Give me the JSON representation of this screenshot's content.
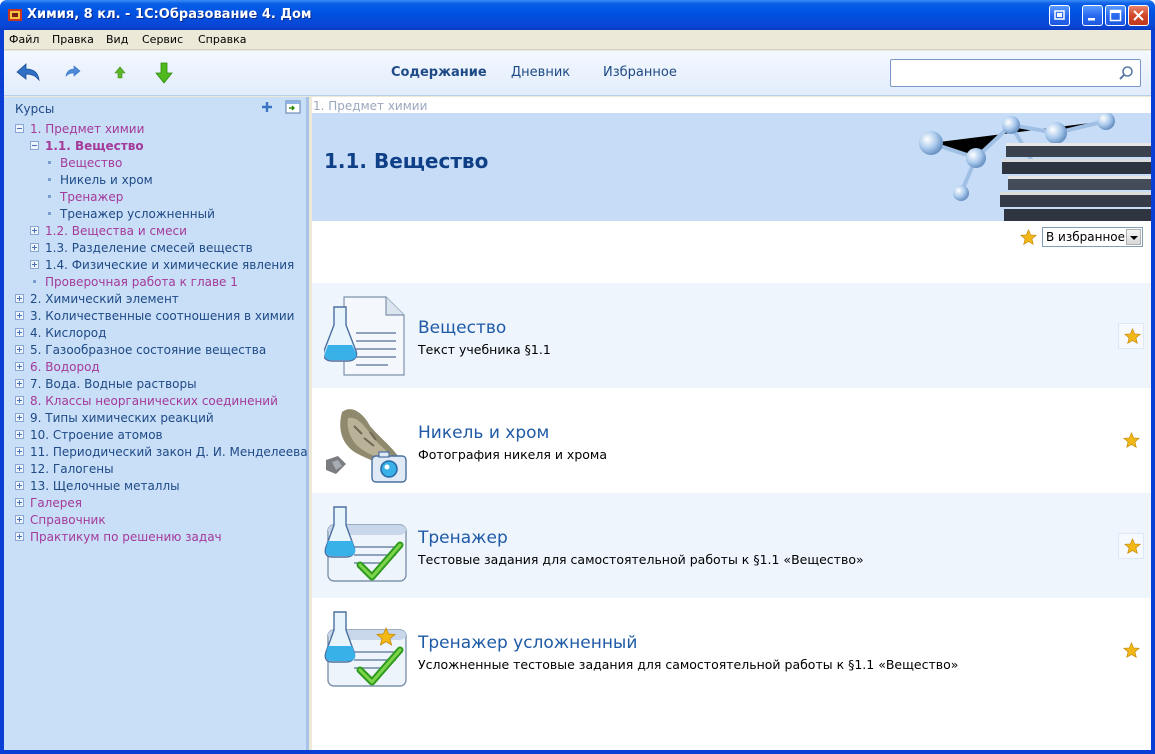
{
  "window": {
    "title": "Химия, 8 кл. - 1С:Образование 4. Дом"
  },
  "menu": [
    "Файл",
    "Правка",
    "Вид",
    "Сервис",
    "Справка"
  ],
  "toolbar": {
    "buttons": [
      "back-icon",
      "forward-icon",
      "up-icon",
      "down-icon"
    ],
    "tabs": [
      "Содержание",
      "Дневник",
      "Избранное"
    ],
    "active_tab": "Содержание",
    "search": {
      "value": "",
      "placeholder": ""
    }
  },
  "sidebar": {
    "title": "Курсы",
    "tree": [
      {
        "label": "1. Предмет химии",
        "level": 0,
        "kind": "minus",
        "color": "purple"
      },
      {
        "label": "1.1. Вещество",
        "level": 1,
        "kind": "minus",
        "color": "purple",
        "bold": true
      },
      {
        "label": "Вещество",
        "level": 2,
        "kind": "bullet",
        "color": "purple"
      },
      {
        "label": "Никель и хром",
        "level": 2,
        "kind": "bullet",
        "color": "blue"
      },
      {
        "label": "Тренажер",
        "level": 2,
        "kind": "bullet",
        "color": "purple"
      },
      {
        "label": "Тренажер усложненный",
        "level": 2,
        "kind": "bullet",
        "color": "blue"
      },
      {
        "label": "1.2. Вещества и смеси",
        "level": 1,
        "kind": "plus",
        "color": "purple"
      },
      {
        "label": "1.3. Разделение смесей веществ",
        "level": 1,
        "kind": "plus",
        "color": "blue"
      },
      {
        "label": "1.4. Физические и химические явления",
        "level": 1,
        "kind": "plus",
        "color": "blue"
      },
      {
        "label": "Проверочная работа к главе 1",
        "level": 1,
        "kind": "bullet",
        "color": "purple"
      },
      {
        "label": "2. Химический элемент",
        "level": 0,
        "kind": "plus",
        "color": "blue"
      },
      {
        "label": "3. Количественные соотношения в химии",
        "level": 0,
        "kind": "plus",
        "color": "blue"
      },
      {
        "label": "4. Кислород",
        "level": 0,
        "kind": "plus",
        "color": "blue"
      },
      {
        "label": "5. Газообразное состояние вещества",
        "level": 0,
        "kind": "plus",
        "color": "blue"
      },
      {
        "label": "6. Водород",
        "level": 0,
        "kind": "plus",
        "color": "purple"
      },
      {
        "label": "7. Вода. Водные растворы",
        "level": 0,
        "kind": "plus",
        "color": "blue"
      },
      {
        "label": "8. Классы неорганических соединений",
        "level": 0,
        "kind": "plus",
        "color": "purple"
      },
      {
        "label": "9. Типы химических реакций",
        "level": 0,
        "kind": "plus",
        "color": "blue"
      },
      {
        "label": "10. Строение атомов",
        "level": 0,
        "kind": "plus",
        "color": "blue"
      },
      {
        "label": "11. Периодический закон Д. И. Менделеева",
        "level": 0,
        "kind": "plus",
        "color": "blue"
      },
      {
        "label": "12. Галогены",
        "level": 0,
        "kind": "plus",
        "color": "blue"
      },
      {
        "label": "13. Щелочные металлы",
        "level": 0,
        "kind": "plus",
        "color": "blue"
      },
      {
        "label": "Галерея",
        "level": 0,
        "kind": "plus",
        "color": "purple"
      },
      {
        "label": "Справочник",
        "level": 0,
        "kind": "plus",
        "color": "purple"
      },
      {
        "label": "Практикум по решению задач",
        "level": 0,
        "kind": "plus",
        "color": "purple"
      }
    ]
  },
  "main": {
    "breadcrumb": "1. Предмет химии",
    "heading": "1.1. Вещество",
    "favorites_select": "В избранное",
    "items": [
      {
        "title": "Вещество",
        "subtitle": "Текст учебника §1.1",
        "icon": "textbook-icon"
      },
      {
        "title": "Никель и хром",
        "subtitle": "Фотография никеля и хрома",
        "icon": "photo-icon"
      },
      {
        "title": "Тренажер",
        "subtitle": "Тестовые задания для самостоятельной работы к §1.1 «Вещество»",
        "icon": "test-icon"
      },
      {
        "title": "Тренажер усложненный",
        "subtitle": "Усложненные тестовые задания для самостоятельной работы к §1.1 «Вещество»",
        "icon": "advanced-test-icon"
      }
    ]
  },
  "colors": {
    "title_bar": "#0054e3",
    "sidebar_bg": "#c9def7",
    "banner_bg": "#c6dcf7",
    "link_blue": "#1e4a86",
    "link_purple": "#a43a9a",
    "star": "#f2b818"
  }
}
